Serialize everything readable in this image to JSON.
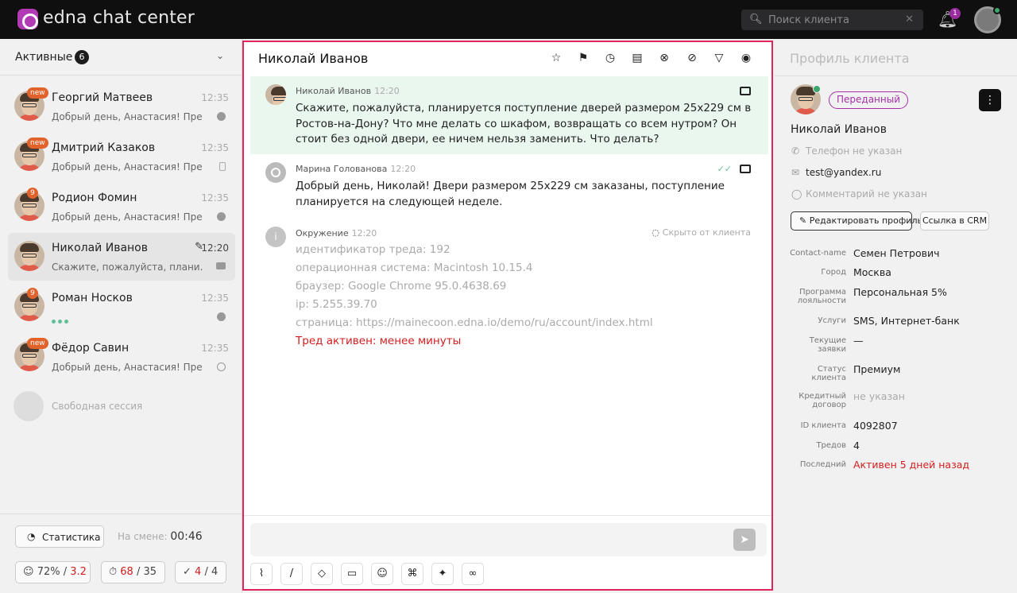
{
  "app": {
    "brand": "edna chat center"
  },
  "header": {
    "search_placeholder": "Поиск клиента",
    "notifications_count": "1"
  },
  "sidebar": {
    "title": "Активные",
    "count": "6",
    "items": [
      {
        "name": "Георгий Матвеев",
        "time": "12:35",
        "preview": "Добрый день, Анастасия! Пред...",
        "badge": "new",
        "channel": "telegram-icon"
      },
      {
        "name": "Дмитрий Казаков",
        "time": "12:35",
        "preview": "Добрый день, Анастасия! Пред...",
        "badge": "new",
        "channel": "phone-icon"
      },
      {
        "name": "Родион Фомин",
        "time": "12:35",
        "preview": "Добрый день, Анастасия! Пред...",
        "badge": "9",
        "channel": "telegram-icon"
      },
      {
        "name": "Николай Иванов",
        "time": "12:20",
        "preview": "Скажите, пожалуйста, плани...",
        "badge": "",
        "channel": "monitor-icon"
      },
      {
        "name": "Роман Носков",
        "time": "12:35",
        "preview": "",
        "badge": "9",
        "channel": "telegram-icon"
      },
      {
        "name": "Фёдор Савин",
        "time": "12:35",
        "preview": "Добрый день, Анастасия! Пред...",
        "badge": "new",
        "channel": "whatsapp-icon"
      }
    ],
    "free_session": "Свободная сессия",
    "stats_button": "Статистика",
    "shift_label": "На смене:",
    "shift_time": "00:46",
    "metrics": {
      "satisfaction": "72%",
      "satisfaction_red": "3.2",
      "time_red": "68",
      "time_total": "35",
      "done_red": "4",
      "done_total": "4"
    }
  },
  "chat": {
    "title": "Николай Иванов",
    "messages": [
      {
        "author": "Николай Иванов",
        "time": "12:20",
        "text": "Скажите, пожалуйста, планируется поступление дверей размером 25х229 см в Ростов-на-Дону? Что мне делать со шкафом, возвращать со всем нутром? Он стоит без одной двери, ее ничем нельзя заменить. Что делать?"
      },
      {
        "author": "Марина Голованова",
        "time": "12:20",
        "text": "Добрый день, Николай! Двери размером 25х229 см заказаны, поступление планируется на следующей неделе."
      }
    ],
    "environment": {
      "author": "Окружение",
      "time": "12:20",
      "hidden_label": "Скрыто от клиента",
      "lines": [
        "идентификатор треда: 192",
        "операционная система: Macintosh 10.15.4",
        "браузер: Google Chrome 95.0.4638.69",
        "ip: 5.255.39.70",
        "страница: https://mainecoon.edna.io/demo/ru/account/index.html"
      ],
      "status": "Тред активен: менее минуты"
    },
    "composer_placeholder": ""
  },
  "profile": {
    "title": "Профиль клиента",
    "status_tag": "Переданный",
    "name": "Николай Иванов",
    "phone": "Телефон не указан",
    "email": "test@yandex.ru",
    "comment": "Комментарий не указан",
    "edit_button": "Редактировать профиль",
    "crm_button": "Ссылка в CRM",
    "fields": [
      {
        "key": "Contact-name",
        "value": "Семен Петрович"
      },
      {
        "key": "Город",
        "value": "Москва"
      },
      {
        "key": "Программа лояльности",
        "value": "Персональная 5%"
      },
      {
        "key": "Услуги",
        "value": "SMS, Интернет-банк"
      },
      {
        "key": "Текущие заявки",
        "value": "—"
      },
      {
        "key": "Статус клиента",
        "value": "Премиум"
      },
      {
        "key": "Кредитный договор",
        "value": "не указан"
      },
      {
        "key": "ID клиента",
        "value": "4092807"
      },
      {
        "key": "Тредов",
        "value": "4"
      },
      {
        "key": "Последний",
        "value": "Активен 5 дней назад"
      }
    ]
  },
  "colors": {
    "accent": "#a62fa9",
    "frame": "#e0245e",
    "client_bubble": "#e9f7ef",
    "alert": "#d21e1e"
  }
}
